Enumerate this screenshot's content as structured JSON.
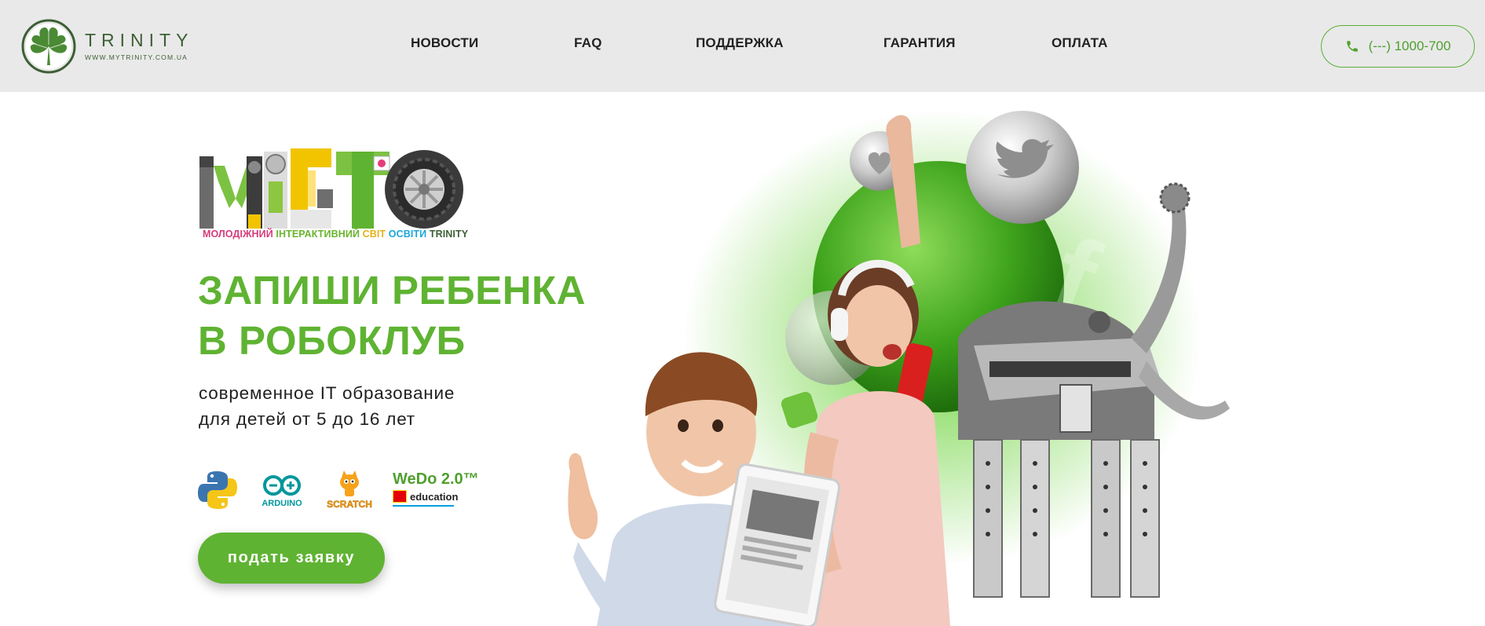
{
  "header": {
    "logo": {
      "name": "TRINITY",
      "url_text": "WWW.MYTRINITY.COM.UA"
    },
    "nav": [
      {
        "label": "НОВОСТИ"
      },
      {
        "label": "FAQ"
      },
      {
        "label": "ПОДДЕРЖКА"
      },
      {
        "label": "ГАРАНТИЯ"
      },
      {
        "label": "ОПЛАТА"
      }
    ],
    "phone": {
      "text": "(---) 1000-700",
      "icon": "phone-icon"
    }
  },
  "hero": {
    "misto_logo": {
      "word": "МІСТО",
      "subtitle": [
        {
          "text": "МОЛОДІЖНИЙ",
          "color": "#d63b7b"
        },
        {
          "text": "ІНТЕРАКТИВНИЙ",
          "color": "#6ab42e"
        },
        {
          "text": "СВІТ",
          "color": "#e8b21c"
        },
        {
          "text": "ОСВІТИ",
          "color": "#1aa6d9"
        },
        {
          "text": "TRINITY",
          "color": "#3d5f35"
        }
      ]
    },
    "title_lines": [
      "ЗАПИШИ РЕБЕНКА",
      "В РОБОКЛУБ"
    ],
    "subtitle_lines": [
      "современное IT образование",
      "для детей от 5 до 16 лет"
    ],
    "tech_logos": [
      {
        "icon": "python-icon",
        "label": ""
      },
      {
        "icon": "arduino-icon",
        "label": "ARDUINO"
      },
      {
        "icon": "scratch-icon",
        "label": "SCRATCH"
      },
      {
        "icon": "wedo-icon",
        "label": "WeDo 2.0™",
        "sublabel": "education"
      }
    ],
    "cta_label": "подать заявку"
  },
  "colors": {
    "accent_green": "#5fb332",
    "header_bg": "#e9e9e9",
    "phone_green": "#4fa02e",
    "logo_green": "#3d5f35"
  }
}
